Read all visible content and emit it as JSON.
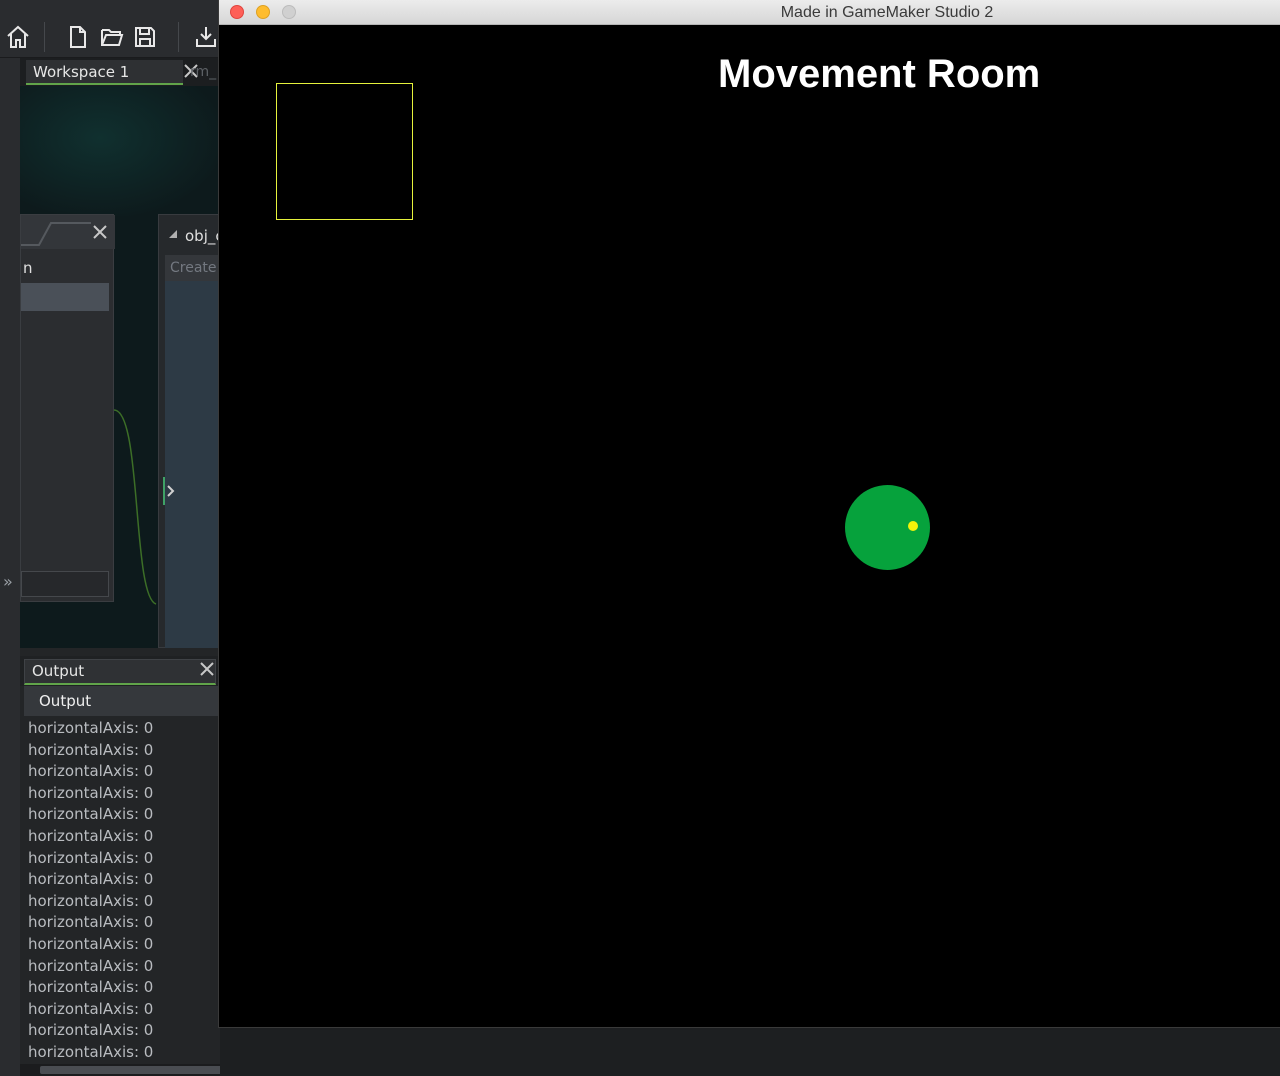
{
  "ide": {
    "toolbar": {
      "icons": [
        "home-icon",
        "new-file-icon",
        "open-folder-icon",
        "save-icon",
        "export-icon"
      ]
    },
    "workspace": {
      "tab_label": "Workspace 1",
      "second_tab_label": "rm_",
      "panel_a": {
        "visible_letter": "n"
      },
      "panel_b": {
        "title": "obj_c",
        "create_label": "Create"
      },
      "side_chevrons": "»"
    },
    "output": {
      "tab_label": "Output",
      "header": "Output",
      "lines": [
        "horizontalAxis: 0",
        "horizontalAxis: 0",
        "horizontalAxis: 0",
        "horizontalAxis: 0",
        "horizontalAxis: 0",
        "horizontalAxis: 0",
        "horizontalAxis: 0",
        "horizontalAxis: 0",
        "horizontalAxis: 0",
        "horizontalAxis: 0",
        "horizontalAxis: 0",
        "horizontalAxis: 0",
        "horizontalAxis: 0",
        "horizontalAxis: 0",
        "horizontalAxis: 0",
        "horizontalAxis: 0"
      ]
    },
    "accent_color": "#61a44a"
  },
  "game_window": {
    "title": "Made in GameMaker Studio 2",
    "room_title": "Movement Room",
    "colors": {
      "background": "#000000",
      "player": "#06a23c",
      "player_eye": "#f2f40a",
      "box_outline": "#e6f23c"
    }
  }
}
